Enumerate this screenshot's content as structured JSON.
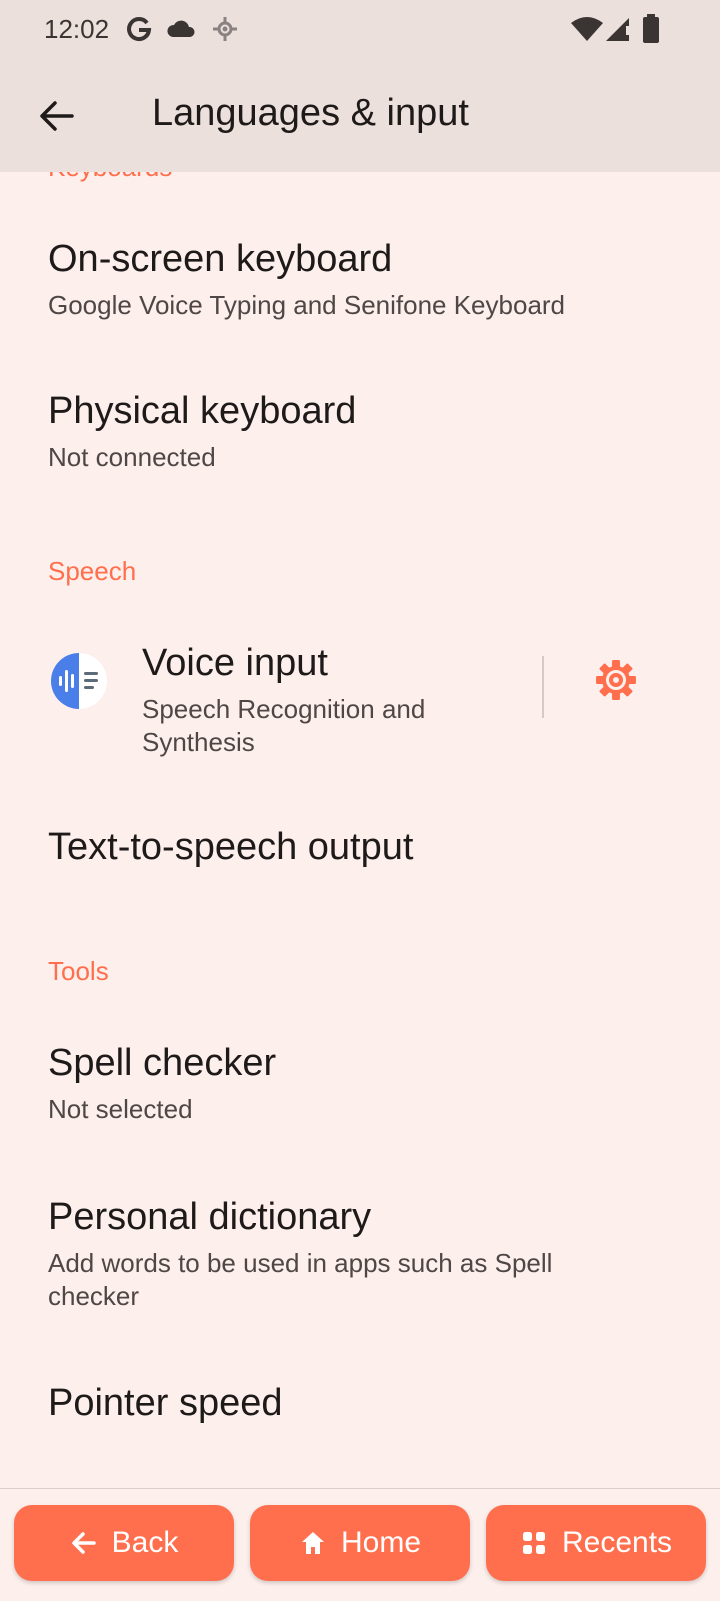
{
  "status_bar": {
    "time": "12:02",
    "icons": [
      "google-icon",
      "cloud-icon",
      "location-icon",
      "wifi-icon",
      "signal-icon",
      "battery-icon"
    ]
  },
  "app_bar": {
    "title": "Languages & input"
  },
  "sections": {
    "keyboards_header": "Keyboards",
    "speech_header": "Speech",
    "tools_header": "Tools"
  },
  "items": {
    "on_screen_keyboard": {
      "title": "On-screen keyboard",
      "subtitle": "Google Voice Typing and Senifone Keyboard"
    },
    "physical_keyboard": {
      "title": "Physical keyboard",
      "subtitle": "Not connected"
    },
    "voice_input": {
      "title": "Voice input",
      "subtitle_line1": "Speech Recognition and",
      "subtitle_line2": "Synthesis"
    },
    "tts_output": {
      "title": "Text-to-speech output"
    },
    "spell_checker": {
      "title": "Spell checker",
      "subtitle": "Not selected"
    },
    "personal_dictionary": {
      "title": "Personal dictionary",
      "subtitle_line1": "Add words to be used in apps such as Spell",
      "subtitle_line2": "checker"
    },
    "pointer_speed": {
      "title": "Pointer speed"
    }
  },
  "nav": {
    "back": "Back",
    "home": "Home",
    "recents": "Recents"
  },
  "colors": {
    "accent": "#ff6f4d",
    "background": "#fcefec",
    "bar": "#ece0dc"
  }
}
